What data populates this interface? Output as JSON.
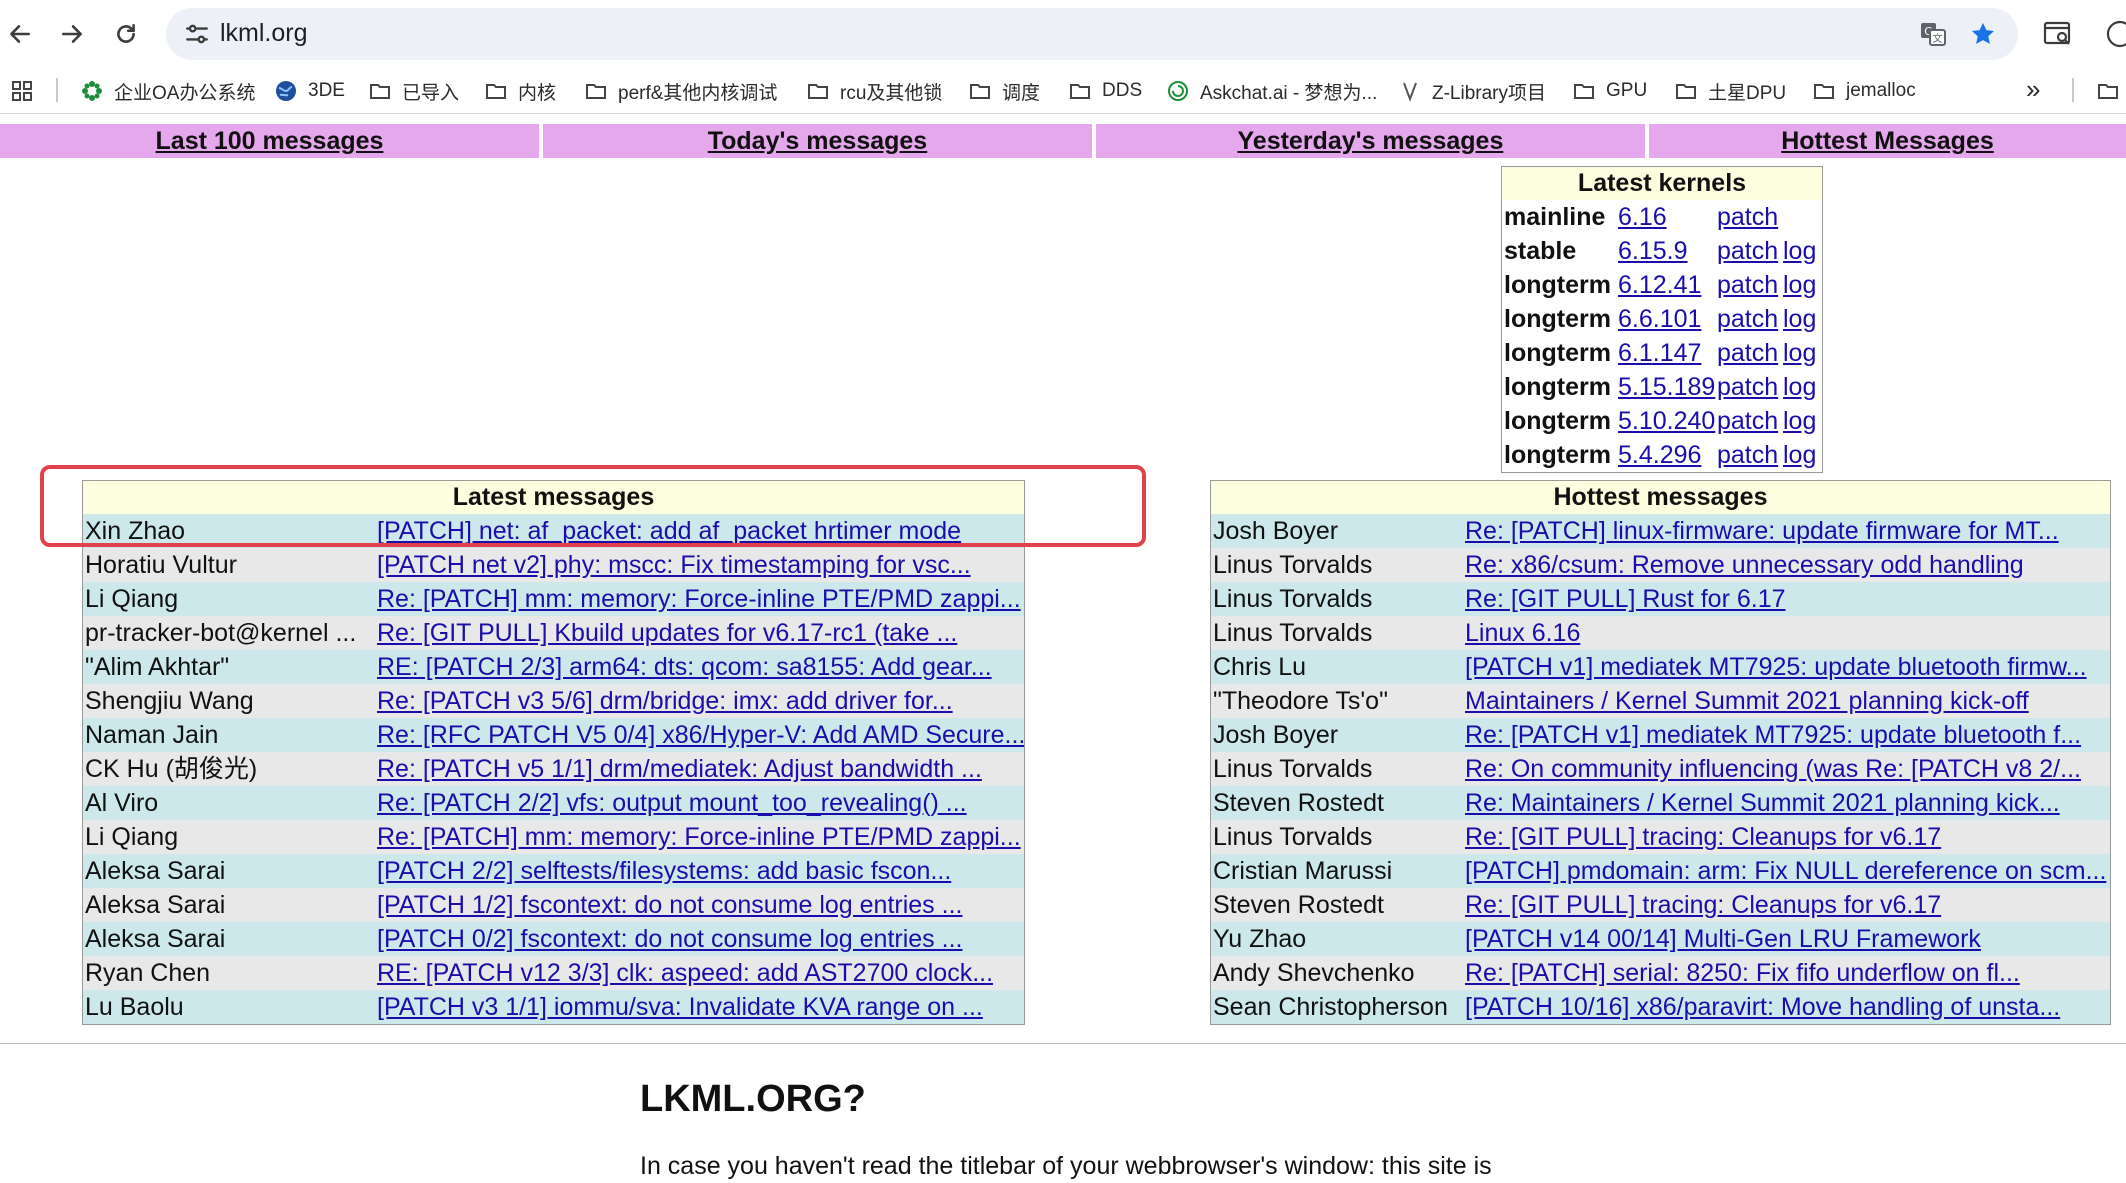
{
  "browser": {
    "url": "lkml.org",
    "bookmarks": [
      {
        "label": "",
        "icon": "apps-grid-icon"
      },
      {
        "label": "企业OA办公系统",
        "icon": "flower-icon"
      },
      {
        "label": "3DE",
        "icon": "globe-icon"
      },
      {
        "label": "已导入",
        "icon": "folder-icon"
      },
      {
        "label": "内核",
        "icon": "folder-icon"
      },
      {
        "label": "perf&其他内核调试",
        "icon": "folder-icon"
      },
      {
        "label": "rcu及其他锁",
        "icon": "folder-icon"
      },
      {
        "label": "调度",
        "icon": "folder-icon"
      },
      {
        "label": "DDS",
        "icon": "folder-icon"
      },
      {
        "label": "Askchat.ai - 梦想为...",
        "icon": "spiral-icon"
      },
      {
        "label": "Z-Library项目",
        "icon": "zlib-icon"
      },
      {
        "label": "GPU",
        "icon": "folder-icon"
      },
      {
        "label": "土星DPU",
        "icon": "folder-icon"
      },
      {
        "label": "jemalloc",
        "icon": "folder-icon"
      }
    ],
    "overflow_label": "»"
  },
  "topnav": [
    {
      "label": "Last 100 messages"
    },
    {
      "label": "Today's messages"
    },
    {
      "label": "Yesterday's messages"
    },
    {
      "label": "Hottest Messages"
    }
  ],
  "kernels": {
    "title": "Latest kernels",
    "rows": [
      {
        "branch": "mainline",
        "version": "6.16",
        "patch": "patch",
        "log": ""
      },
      {
        "branch": "stable",
        "version": "6.15.9",
        "patch": "patch",
        "log": "log"
      },
      {
        "branch": "longterm",
        "version": "6.12.41",
        "patch": "patch",
        "log": "log"
      },
      {
        "branch": "longterm",
        "version": "6.6.101",
        "patch": "patch",
        "log": "log"
      },
      {
        "branch": "longterm",
        "version": "6.1.147",
        "patch": "patch",
        "log": "log"
      },
      {
        "branch": "longterm",
        "version": "5.15.189",
        "patch": "patch",
        "log": "log"
      },
      {
        "branch": "longterm",
        "version": "5.10.240",
        "patch": "patch",
        "log": "log"
      },
      {
        "branch": "longterm",
        "version": "5.4.296",
        "patch": "patch",
        "log": "log"
      }
    ]
  },
  "latest_messages": {
    "title": "Latest messages",
    "rows": [
      {
        "author": "Xin Zhao",
        "subject": "[PATCH] net: af_packet: add af_packet hrtimer mode"
      },
      {
        "author": "Horatiu Vultur",
        "subject": "[PATCH net v2] phy: mscc: Fix timestamping for vsc..."
      },
      {
        "author": "Li Qiang",
        "subject": "Re: [PATCH] mm: memory: Force-inline PTE/PMD zappi..."
      },
      {
        "author": "pr-tracker-bot@kernel ...",
        "subject": "Re: [GIT PULL] Kbuild updates for v6.17-rc1 (take ..."
      },
      {
        "author": "\"Alim Akhtar\"",
        "subject": "RE: [PATCH 2/3] arm64: dts: qcom: sa8155: Add gear..."
      },
      {
        "author": "Shengjiu Wang",
        "subject": "Re: [PATCH v3 5/6] drm/bridge: imx: add driver for..."
      },
      {
        "author": "Naman Jain",
        "subject": "Re: [RFC PATCH V5 0/4] x86/Hyper-V: Add AMD Secure..."
      },
      {
        "author": "CK Hu (胡俊光)",
        "subject": "Re: [PATCH v5 1/1] drm/mediatek: Adjust bandwidth ..."
      },
      {
        "author": "Al Viro",
        "subject": "Re: [PATCH 2/2] vfs: output mount_too_revealing() ..."
      },
      {
        "author": "Li Qiang",
        "subject": "Re: [PATCH] mm: memory: Force-inline PTE/PMD zappi..."
      },
      {
        "author": "Aleksa Sarai",
        "subject": "[PATCH 2/2] selftests/filesystems: add basic fscon..."
      },
      {
        "author": "Aleksa Sarai",
        "subject": "[PATCH 1/2] fscontext: do not consume log entries ..."
      },
      {
        "author": "Aleksa Sarai",
        "subject": "[PATCH 0/2] fscontext: do not consume log entries ..."
      },
      {
        "author": "Ryan Chen",
        "subject": "RE: [PATCH v12 3/3] clk: aspeed: add AST2700 clock..."
      },
      {
        "author": "Lu Baolu",
        "subject": "[PATCH v3 1/1] iommu/sva: Invalidate KVA range on ..."
      }
    ]
  },
  "hottest_messages": {
    "title": "Hottest messages",
    "rows": [
      {
        "author": "Josh Boyer",
        "subject": "Re: [PATCH] linux-firmware: update firmware for MT..."
      },
      {
        "author": "Linus Torvalds",
        "subject": "Re: x86/csum: Remove unnecessary odd handling"
      },
      {
        "author": "Linus Torvalds",
        "subject": "Re: [GIT PULL] Rust for 6.17"
      },
      {
        "author": "Linus Torvalds",
        "subject": "Linux 6.16"
      },
      {
        "author": "Chris Lu",
        "subject": "[PATCH v1] mediatek MT7925: update bluetooth firmw..."
      },
      {
        "author": "\"Theodore Ts'o\"",
        "subject": "Maintainers / Kernel Summit 2021 planning kick-off"
      },
      {
        "author": "Josh Boyer",
        "subject": "Re: [PATCH v1] mediatek MT7925: update bluetooth f..."
      },
      {
        "author": "Linus Torvalds",
        "subject": "Re: On community influencing (was Re: [PATCH v8 2/..."
      },
      {
        "author": "Steven Rostedt",
        "subject": "Re: Maintainers / Kernel Summit 2021 planning kick..."
      },
      {
        "author": "Linus Torvalds",
        "subject": "Re: [GIT PULL] tracing: Cleanups for v6.17"
      },
      {
        "author": "Cristian Marussi",
        "subject": "[PATCH] pmdomain: arm: Fix NULL dereference on scm..."
      },
      {
        "author": "Steven Rostedt",
        "subject": "Re: [GIT PULL] tracing: Cleanups for v6.17"
      },
      {
        "author": "Yu Zhao",
        "subject": "[PATCH v14 00/14] Multi-Gen LRU Framework"
      },
      {
        "author": "Andy Shevchenko",
        "subject": "Re: [PATCH] serial: 8250: Fix fifo underflow on fl..."
      },
      {
        "author": "Sean Christopherson",
        "subject": "[PATCH 10/16] x86/paravirt: Move handling of unsta..."
      }
    ]
  },
  "about": {
    "title": "LKML.ORG?",
    "text": "In case you haven't read the titlebar of your webbrowser's window: this site is"
  },
  "colors": {
    "nav_bg": "#e6a8ec",
    "header_bg": "#fdfde0",
    "row_odd": "#cde8ea",
    "row_even": "#e8e8e8",
    "link": "#1a0dab",
    "highlight": "#e2404a"
  }
}
